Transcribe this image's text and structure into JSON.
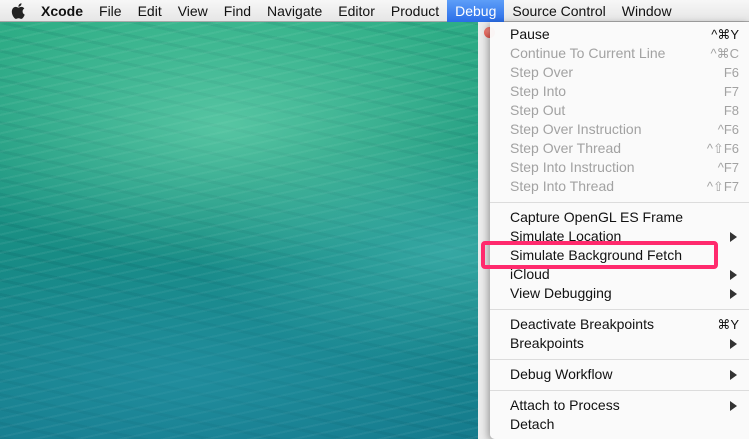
{
  "menubar": {
    "app_name": "Xcode",
    "items": [
      "File",
      "Edit",
      "View",
      "Find",
      "Navigate",
      "Editor",
      "Product",
      "Debug",
      "Source Control",
      "Window"
    ],
    "active_item": "Debug"
  },
  "debug_menu": {
    "items": [
      {
        "label": "Pause",
        "shortcut": "^⌘Y",
        "enabled": true
      },
      {
        "label": "Continue To Current Line",
        "shortcut": "^⌘C",
        "enabled": false
      },
      {
        "label": "Step Over",
        "shortcut": "F6",
        "enabled": false
      },
      {
        "label": "Step Into",
        "shortcut": "F7",
        "enabled": false
      },
      {
        "label": "Step Out",
        "shortcut": "F8",
        "enabled": false
      },
      {
        "label": "Step Over Instruction",
        "shortcut": "^F6",
        "enabled": false
      },
      {
        "label": "Step Over Thread",
        "shortcut": "^⇧F6",
        "enabled": false
      },
      {
        "label": "Step Into Instruction",
        "shortcut": "^F7",
        "enabled": false
      },
      {
        "label": "Step Into Thread",
        "shortcut": "^⇧F7",
        "enabled": false
      },
      {
        "label": "Capture OpenGL ES Frame",
        "enabled": true
      },
      {
        "label": "Simulate Location",
        "submenu": true,
        "enabled": true
      },
      {
        "label": "Simulate Background Fetch",
        "enabled": true,
        "highlighted": true
      },
      {
        "label": "iCloud",
        "submenu": true,
        "enabled": true
      },
      {
        "label": "View Debugging",
        "submenu": true,
        "enabled": true
      },
      {
        "label": "Deactivate Breakpoints",
        "shortcut": "⌘Y",
        "enabled": true
      },
      {
        "label": "Breakpoints",
        "submenu": true,
        "enabled": true
      },
      {
        "label": "Debug Workflow",
        "submenu": true,
        "enabled": true
      },
      {
        "label": "Attach to Process",
        "submenu": true,
        "enabled": true
      },
      {
        "label": "Detach",
        "enabled": true
      }
    ]
  },
  "colors": {
    "menubar_active": "#2a6de8",
    "highlight_box": "#ff2a6d",
    "disabled_text": "#a2a2a2"
  }
}
